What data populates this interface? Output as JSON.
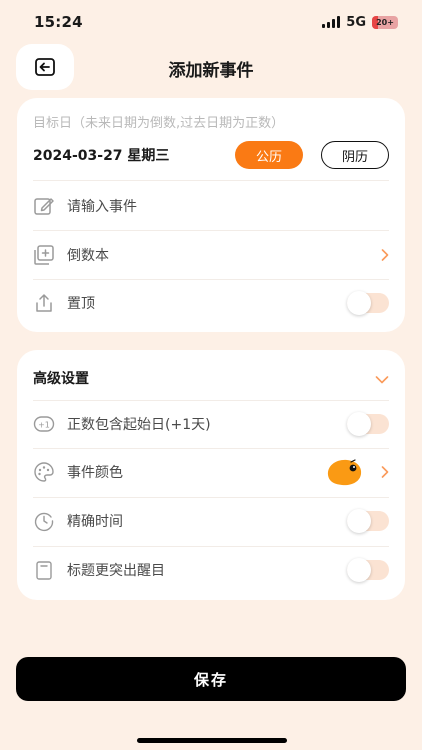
{
  "status": {
    "time": "15:24",
    "network": "5G",
    "battery": "20+"
  },
  "header": {
    "title": "添加新事件"
  },
  "date_card": {
    "hint": "目标日（未来日期为倒数,过去日期为正数）",
    "date": "2024-03-27 星期三",
    "solar_label": "公历",
    "lunar_label": "阴历",
    "event_placeholder": "请输入事件",
    "countdown_book": "倒数本",
    "pin_label": "置顶"
  },
  "advanced": {
    "title": "高级设置",
    "include_start": "正数包含起始日(+1天)",
    "event_color": "事件颜色",
    "precise_time": "精确时间",
    "highlight_title": "标题更突出醒目",
    "accent_color": "#fa9a14"
  },
  "footer": {
    "save_label": "保存"
  },
  "colors": {
    "background": "#fdf0e6",
    "accent": "#fa7a14",
    "toggle_off": "#fbe3d3"
  }
}
